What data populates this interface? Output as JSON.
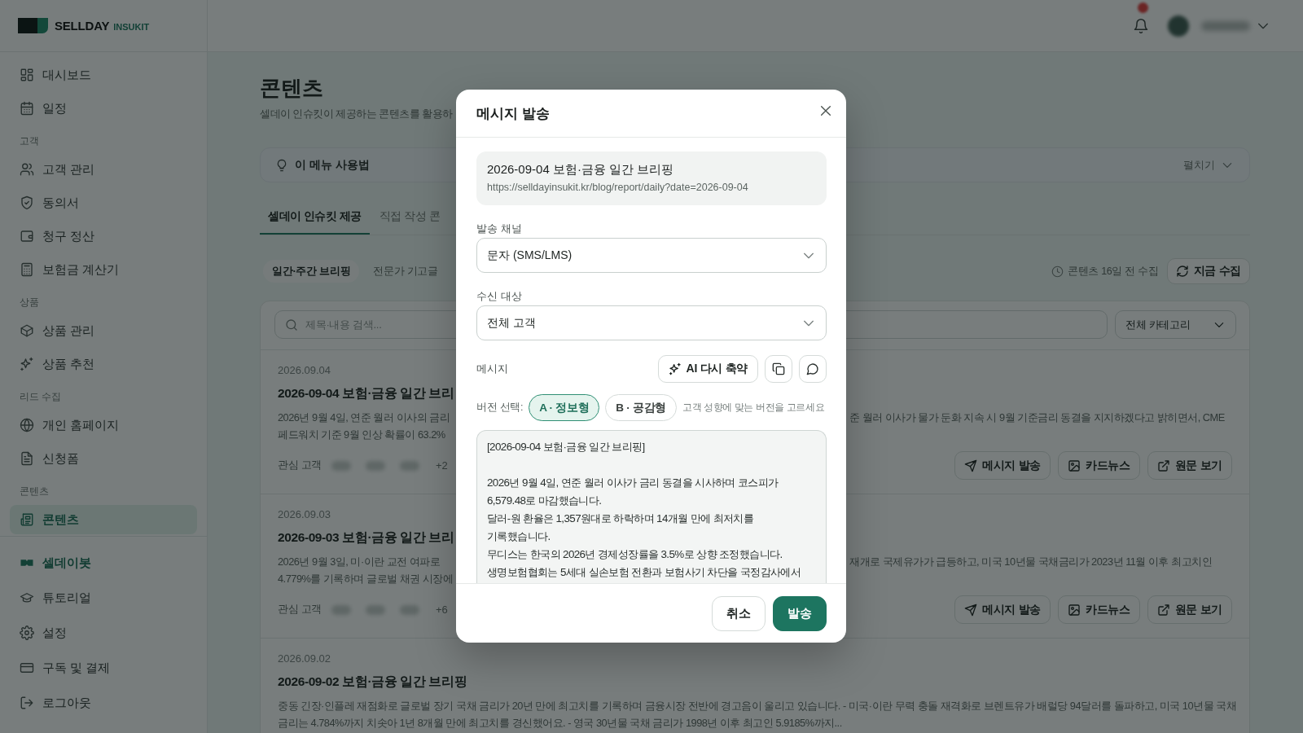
{
  "sidebar": {
    "brand": "SELLDAY",
    "brand_sub": "INSUKIT",
    "sections": [
      {
        "items": [
          {
            "label": "대시보드",
            "selected": false
          },
          {
            "label": "일정",
            "selected": false
          }
        ]
      },
      {
        "title": "고객",
        "items": [
          {
            "label": "고객 관리",
            "selected": false
          },
          {
            "label": "동의서",
            "selected": false
          },
          {
            "label": "청구 정산",
            "selected": false
          },
          {
            "label": "보험금 계산기",
            "selected": false
          }
        ]
      },
      {
        "title": "상품",
        "items": [
          {
            "label": "상품 관리",
            "selected": false
          },
          {
            "label": "상품 추천",
            "selected": false
          }
        ]
      },
      {
        "title": "리드 수집",
        "items": [
          {
            "label": "개인 홈페이지",
            "selected": false
          },
          {
            "label": "신청폼",
            "selected": false
          }
        ]
      },
      {
        "title": "콘텐츠",
        "items": [
          {
            "label": "콘텐츠",
            "selected": true
          }
        ]
      }
    ],
    "bottom_items": [
      {
        "label": "셀데이봇",
        "selected": false,
        "accent": true
      },
      {
        "label": "튜토리얼",
        "selected": false,
        "accent": false
      },
      {
        "label": "설정",
        "selected": false,
        "accent": false
      },
      {
        "label": "구독 및 결제",
        "selected": false,
        "accent": false
      },
      {
        "label": "로그아웃",
        "selected": false,
        "accent": false
      }
    ]
  },
  "header": {
    "notification": {
      "unread": true
    }
  },
  "page": {
    "title": "콘텐츠",
    "subtitle": "셀데이 인슈킷이 제공하는 콘텐츠를 활용하",
    "guide": {
      "label": "이 메뉴 사용법",
      "toggle": "펼치기",
      "expanded": false
    },
    "tabs": [
      {
        "label": "셀데이 인슈킷 제공",
        "selected": true
      },
      {
        "label": "직접 작성 콘",
        "selected": false
      }
    ],
    "filters": [
      {
        "label": "일간·주간 브리핑",
        "selected": true
      },
      {
        "label": "전문가 기고글",
        "selected": false
      }
    ],
    "collected": "콘텐츠 16일 전 수집",
    "collect_button": "지금 수집",
    "search": {
      "placeholder": "제목·내용 검색..."
    },
    "category": {
      "value": "전체 카테고리"
    },
    "items": [
      {
        "date": "2026.09.04",
        "title": "2026-09-04 보험·금융 일간 브리",
        "excerpt_lines": [
          [
            "2026년 9월 4일, 연준 월러 이사의 금리",
            "준 월러 이사가 물가 둔화 지속 시 9월 기준금리 동결을 지지하겠다고 밝히면서, CME"
          ],
          [
            "페드워치 기준 9월 인상 확률이 63.2%"
          ]
        ],
        "interest_label": "관심 고객",
        "more": "+2",
        "actions": [
          "메시지 발송",
          "카드뉴스",
          "원문 보기"
        ]
      },
      {
        "date": "2026.09.03",
        "title": "2026-09-03 보험·금융 일간 브리",
        "excerpt_lines": [
          [
            "2026년 9월 3일, 미·이란 교전 여파로",
            "재개로 국제유가가 급등하고, 미국 10년물 국채금리가 2023년 11월 이후 최고치인"
          ],
          [
            "4.779%를 기록하며 글로벌 채권 시장에"
          ]
        ],
        "interest_label": "관심 고객",
        "more": "+6",
        "actions": [
          "메시지 발송",
          "카드뉴스",
          "원문 보기"
        ]
      },
      {
        "date": "2026.09.02",
        "title": "2026-09-02 보험·금융 일간 브리핑",
        "excerpt_lines": [
          [
            "중동 긴장·인플레 재점화로 글로벌 장기 국채 금리가 20년 만에 최고치를 기록하며 금융시장 전반에 경고음이 울리고 있습니다. - 미국·이란 무력 충돌 재격화로 브렌트유가 배럴당 94달러를 돌파하고, 미국 10년물 국채"
          ],
          [
            "금리는 4.784%까지 치솟아 1년 8개월 만에 최고치를 경신했어요. - 영국 30년물 국채 금리가 1998년 이후 최고인 5.9185%까지..."
          ]
        ]
      }
    ]
  },
  "modal": {
    "title": "메시지 발송",
    "article": {
      "title": "2026-09-04 보험·금융 일간 브리핑",
      "url": "https://selldayinsukit.kr/blog/report/daily?date=2026-09-04"
    },
    "channel": {
      "label": "발송 채널",
      "value": "문자 (SMS/LMS)"
    },
    "recipients": {
      "label": "수신 대상",
      "value": "전체 고객"
    },
    "message": {
      "label": "메시지",
      "ai_button": "AI 다시 축약",
      "version_label": "버전 선택:",
      "versions": [
        {
          "label": "A · 정보형",
          "selected": true
        },
        {
          "label": "B · 공감형",
          "selected": false
        }
      ],
      "version_hint": "고객 성향에 맞는 버전을 고르세요",
      "value": "[2026-09-04 보험·금융 일간 브리핑]\n\n2026년 9월 4일, 연준 월러 이사가 금리 동결을 시사하며 코스피가\n6,579.48로 마감했습니다.\n달러-원 환율은 1,357원대로 하락하며 14개월 만에 최저치를\n기록했습니다.\n무디스는 한국의 2026년 경제성장률을 3.5%로 상향 조정했습니다.\n생명보험협회는 5세대 실손보험 전환과 보험사기 차단을 국정감사에서"
    },
    "buttons": [
      {
        "label": "취소",
        "kind": "secondary"
      },
      {
        "label": "발송",
        "kind": "primary"
      }
    ]
  }
}
